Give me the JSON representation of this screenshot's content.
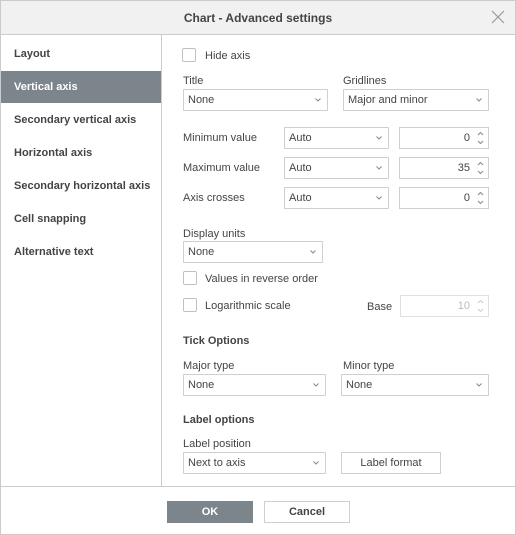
{
  "dialog": {
    "title": "Chart - Advanced settings"
  },
  "sidebar": {
    "items": [
      {
        "label": "Layout"
      },
      {
        "label": "Vertical axis",
        "selected": true
      },
      {
        "label": "Secondary vertical axis"
      },
      {
        "label": "Horizontal axis"
      },
      {
        "label": "Secondary horizontal axis"
      },
      {
        "label": "Cell snapping"
      },
      {
        "label": "Alternative text"
      }
    ]
  },
  "main": {
    "hide_axis": {
      "label": "Hide axis",
      "checked": false
    },
    "title": {
      "label": "Title",
      "value": "None"
    },
    "gridlines": {
      "label": "Gridlines",
      "value": "Major and minor"
    },
    "minimum": {
      "label": "Minimum value",
      "mode": "Auto",
      "value": "0"
    },
    "maximum": {
      "label": "Maximum value",
      "mode": "Auto",
      "value": "35"
    },
    "crosses": {
      "label": "Axis crosses",
      "mode": "Auto",
      "value": "0"
    },
    "display_units": {
      "label": "Display units",
      "value": "None"
    },
    "reverse": {
      "label": "Values in reverse order",
      "checked": false
    },
    "log": {
      "label": "Logarithmic scale",
      "checked": false,
      "base_label": "Base",
      "base": "10"
    },
    "tick": {
      "heading": "Tick Options",
      "major_label": "Major type",
      "major": "None",
      "minor_label": "Minor type",
      "minor": "None"
    },
    "labels": {
      "heading": "Label options",
      "position_label": "Label position",
      "position": "Next to axis",
      "format_button": "Label format"
    }
  },
  "footer": {
    "ok": "OK",
    "cancel": "Cancel"
  },
  "colors": {
    "accent": "#7d858c",
    "border": "#cbcbcb",
    "header_bg": "#f1f1f1"
  }
}
